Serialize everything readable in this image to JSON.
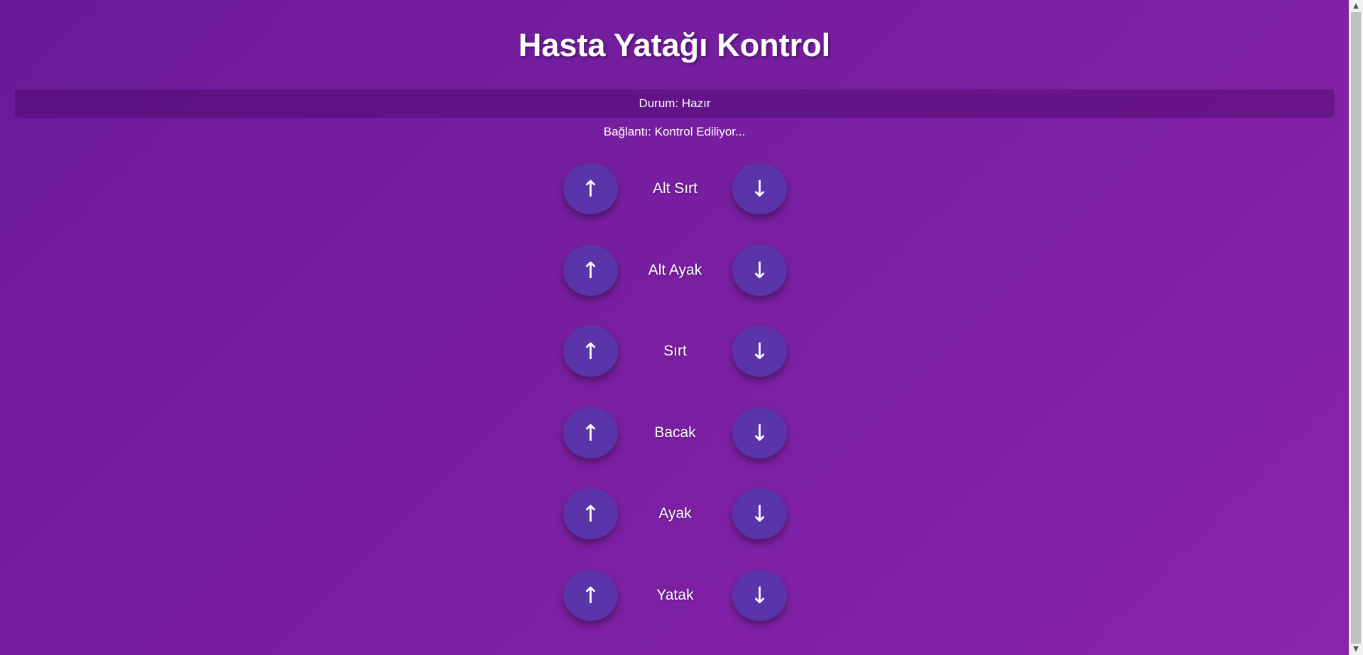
{
  "header": {
    "title": "Hasta Yatağı Kontrol"
  },
  "status": {
    "text": "Durum: Hazır"
  },
  "connection": {
    "text": "Bağlantı: Kontrol Ediliyor..."
  },
  "controls": [
    {
      "label": "Alt Sırt",
      "up": "↑",
      "down": "↓"
    },
    {
      "label": "Alt Ayak",
      "up": "↑",
      "down": "↓"
    },
    {
      "label": "Sırt",
      "up": "↑",
      "down": "↓"
    },
    {
      "label": "Bacak",
      "up": "↑",
      "down": "↓"
    },
    {
      "label": "Ayak",
      "up": "↑",
      "down": "↓"
    },
    {
      "label": "Yatak",
      "up": "↑",
      "down": "↓"
    }
  ],
  "scrollbar": {
    "up_glyph": "▲",
    "down_glyph": "▼"
  },
  "colors": {
    "background": "#7a1fa2",
    "button": "#5a35aa",
    "text": "#ffffff"
  }
}
